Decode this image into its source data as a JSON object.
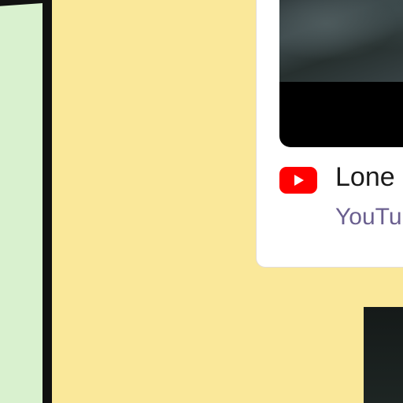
{
  "link_card": {
    "title": "Lone",
    "source": "YouTu",
    "logo_icon": "youtube-logo-icon",
    "logo_color": "#ff0000"
  },
  "colors": {
    "background": "#fae89a",
    "left_panel": "#d9f1cf"
  }
}
